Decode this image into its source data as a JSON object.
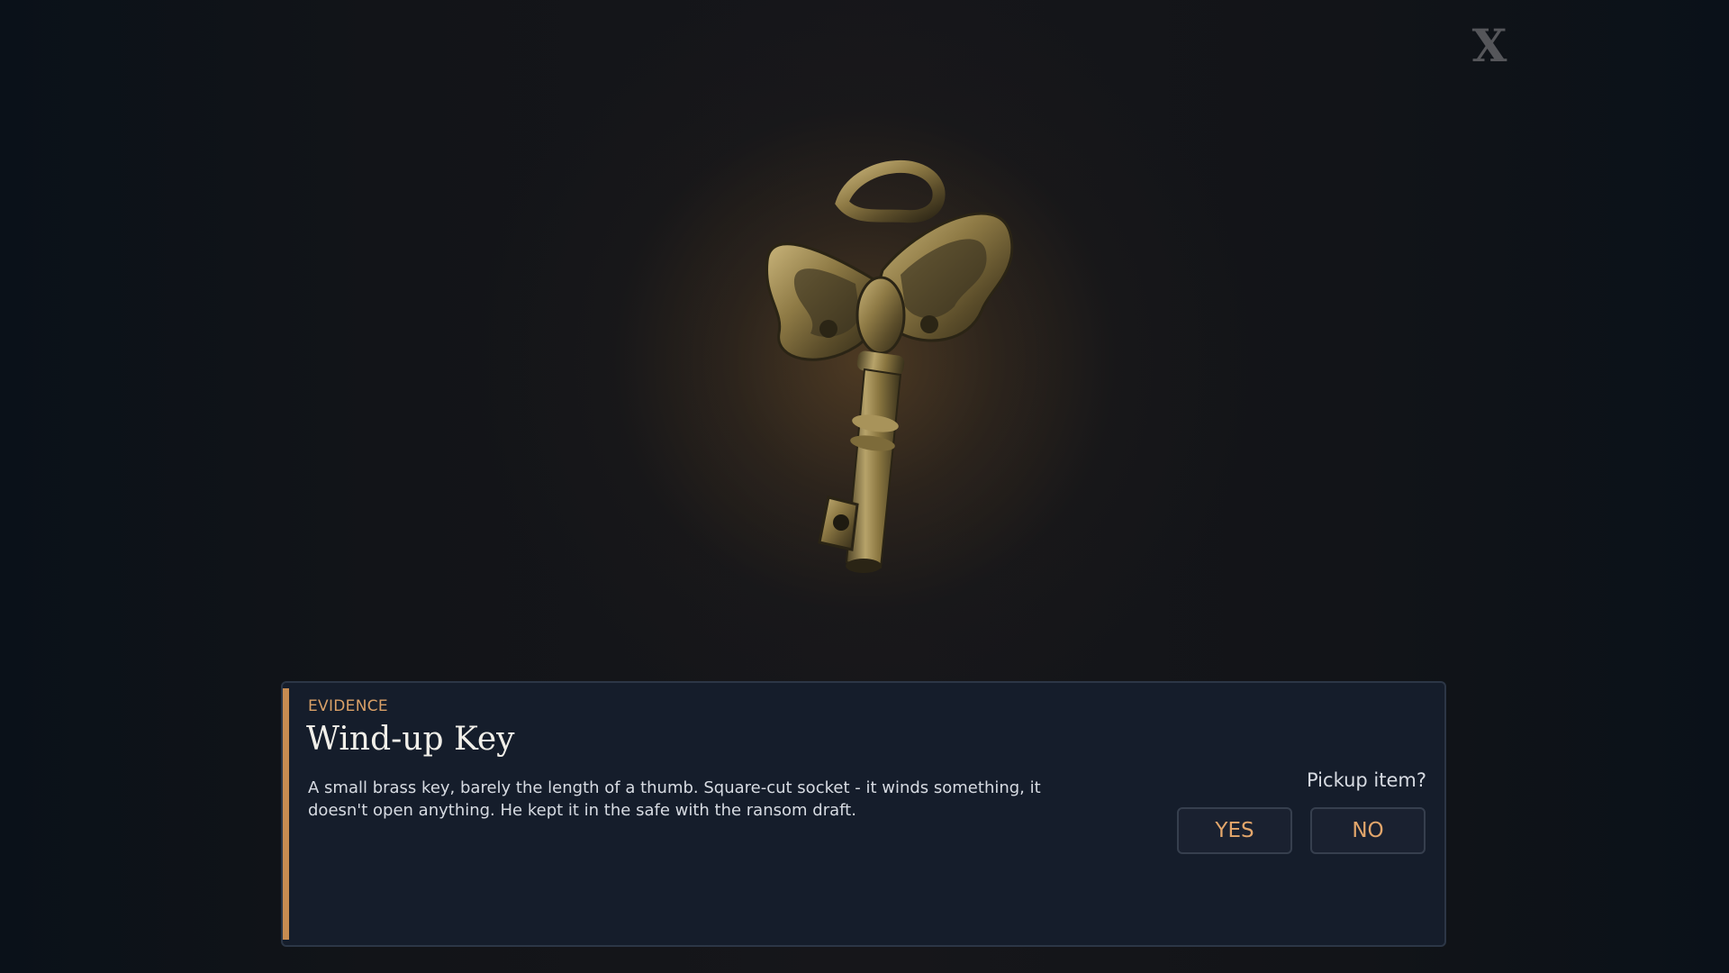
{
  "close": {
    "label": "X"
  },
  "item": {
    "category": "EVIDENCE",
    "title": "Wind-up Key",
    "description": "A small brass key, barely the length of a thumb. Square-cut socket - it winds something, it doesn't open anything. He kept it in the safe with the ransom draft.",
    "icon": "brass-wind-up-key"
  },
  "pickup": {
    "prompt": "Pickup item?",
    "yes_label": "YES",
    "no_label": "NO"
  },
  "colors": {
    "accent": "#c68b51",
    "button_text": "#e3a66b",
    "panel_bg": "#151d2b"
  }
}
